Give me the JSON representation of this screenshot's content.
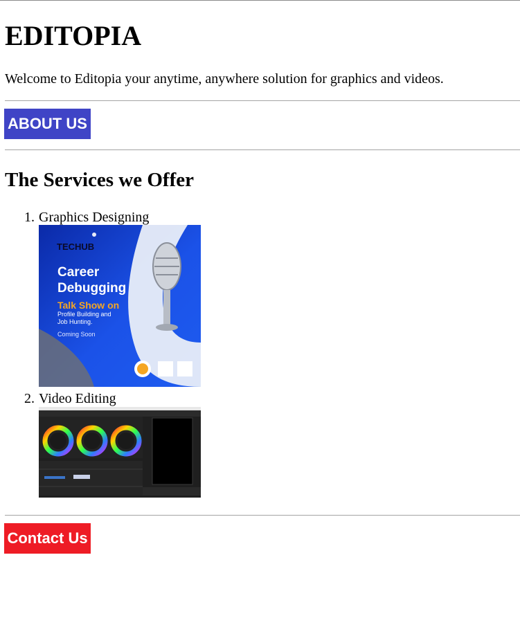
{
  "site": {
    "title": "EDITOPIA",
    "intro": "Welcome to Editopia your anytime, anywhere solution for graphics and videos."
  },
  "buttons": {
    "about_label": "ABOUT US",
    "about_color": "#3f44c6",
    "contact_label": "Contact Us",
    "contact_color": "#ee1c25"
  },
  "services": {
    "title": "The Services we Offer",
    "items": [
      {
        "number": "1.",
        "label": "Graphics Designing"
      },
      {
        "number": "2.",
        "label": "Video Editing"
      }
    ]
  },
  "poster": {
    "brand": "TECHUB",
    "heading_line1": "Career",
    "heading_line2": "Debugging",
    "subheading": "Talk Show on",
    "desc_line1": "Profile Building and",
    "desc_line2": "Job Hunting.",
    "footer": "Coming Soon",
    "accent_color": "#f5a623"
  }
}
